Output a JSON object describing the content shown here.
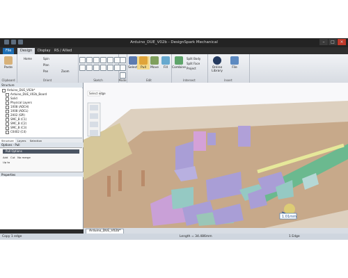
{
  "window": {
    "title": "Arduino_DUE_V02b - DesignSpark Mechanical",
    "controls": [
      "minimize-icon",
      "maximize-icon",
      "close-icon"
    ]
  },
  "ribbon": {
    "tabs": [
      "File",
      "Design",
      "Display",
      "RS / Allied"
    ],
    "groups": {
      "clipboard": {
        "label": "Clipboard",
        "paste": "Paste"
      },
      "orient": {
        "label": "Orient",
        "home": "Home",
        "spin": "Spin",
        "plan": "Plan",
        "pan": "Pan",
        "zoom": "Zoom"
      },
      "sketch": {
        "label": "Sketch"
      },
      "mode": {
        "label": "Mode"
      },
      "edit": {
        "label": "Edit",
        "select": "Select",
        "pull": "Pull",
        "move": "Move",
        "fill": "Fill"
      },
      "intersect": {
        "label": "Intersect",
        "combine": "Combine",
        "split_body": "Split Body",
        "split_face": "Split Face",
        "project": "Project"
      },
      "insert": {
        "label": "Insert",
        "online_library": "Online Library",
        "file": "File"
      }
    }
  },
  "structure_panel": {
    "header": "Structure",
    "items": [
      "Arduino_DUE_V02b*",
      "Arduino_DUE_V02b_Board",
      "Solid",
      "Physical Layers",
      "1X08 (ADCH)",
      "1X08 (ADCL)",
      "2X02 (SPI)",
      "SMC_B (C1)",
      "SMC_B (C2)",
      "SMC_B (C3)",
      "C0402 (C4)"
    ],
    "tabs": [
      "Structure",
      "Layers",
      "Selection"
    ]
  },
  "options_panel": {
    "header": "Options - Pull",
    "title": "Pull Options",
    "row1": [
      "Add",
      "Cut",
      "No merge"
    ],
    "row2": "Up to"
  },
  "properties_panel": {
    "header": "Properties"
  },
  "viewport": {
    "hint": "Select edge",
    "dimension": "1.01mm"
  },
  "document_tab": "Arduino_DUE_V02b*",
  "status": {
    "left": "Copy 1 edge",
    "length": "Length = 34.486mm",
    "selection": "1 Edge"
  },
  "colors": {
    "accent": "#1f6fb5",
    "board": "#c7a98a",
    "component_purple": "#a99ed6",
    "component_teal": "#95c9c3",
    "header_green": "#6bb98f"
  }
}
